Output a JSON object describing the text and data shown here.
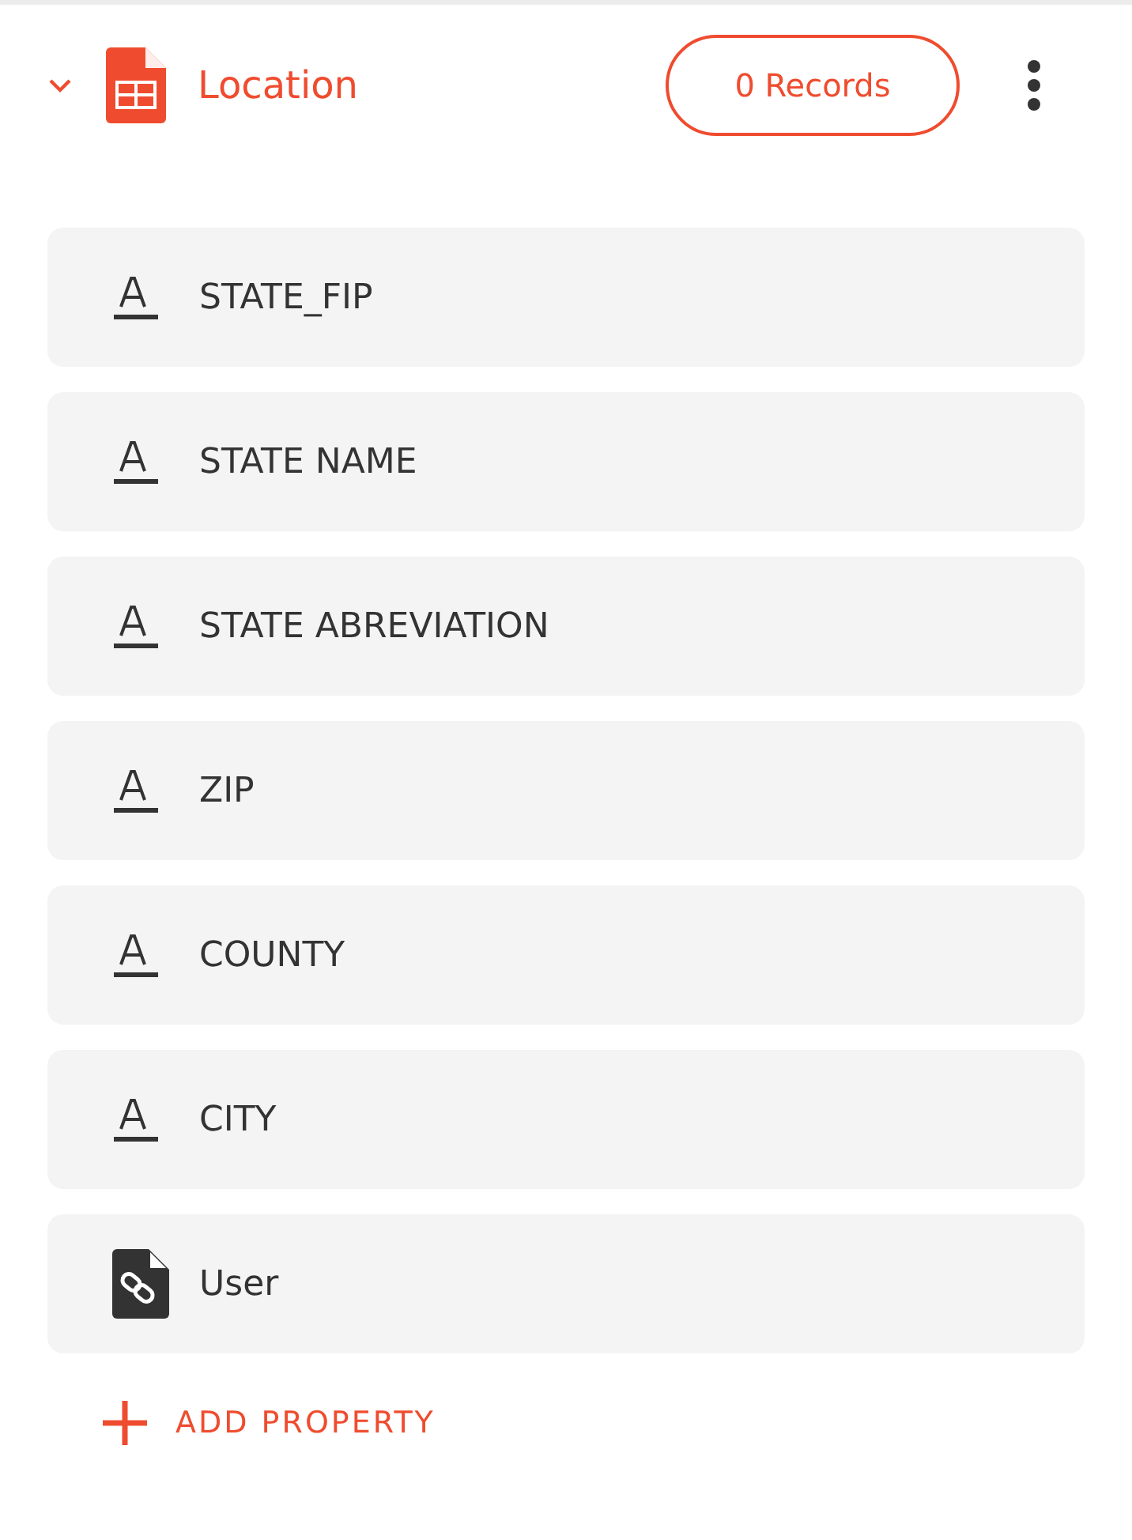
{
  "table": {
    "name": "Location",
    "expanded": true,
    "records_button": "0 Records"
  },
  "properties": [
    {
      "kind": "text",
      "name": "STATE_FIP"
    },
    {
      "kind": "text",
      "name": "STATE NAME"
    },
    {
      "kind": "text",
      "name": "STATE ABREVIATION"
    },
    {
      "kind": "text",
      "name": "ZIP"
    },
    {
      "kind": "text",
      "name": "COUNTY"
    },
    {
      "kind": "text",
      "name": "CITY"
    },
    {
      "kind": "relation",
      "name": "User"
    }
  ],
  "add_button": "ADD PROPERTY"
}
